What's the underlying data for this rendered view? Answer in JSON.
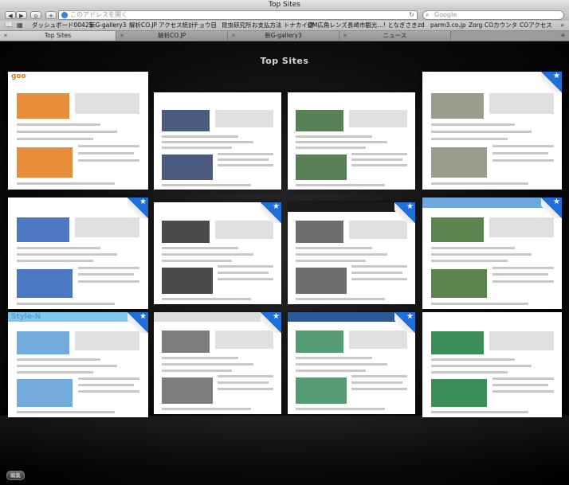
{
  "window": {
    "title": "Top Sites"
  },
  "toolbar": {
    "back_glyph": "◀",
    "forward_glyph": "▶",
    "home_glyph": "⌂",
    "add_glyph": "+",
    "address_placeholder": "このアドレスを開く",
    "reload_glyph": "↻",
    "search_placeholder": "Google",
    "search_glyph": "⌕"
  },
  "bookmarks": {
    "book_glyph": "📖",
    "grid_glyph": "▦",
    "items": [
      "ダッシュボード00425",
      "新G-gallery3",
      "解析CO.JP",
      "アクセス統計",
      "チョウ目",
      "昆虫研究所",
      "お支払方法 トナカイ便",
      "OM広角レンズ",
      "長崎市観光…! となぎさき",
      "zd",
      "parm3.co.jp",
      "Zorg",
      "COカウンタ",
      "COアクセス"
    ],
    "more_glyph": "»"
  },
  "tabs": {
    "items": [
      "Top Sites",
      "解析CO.JP",
      "新G-gallery3",
      "ニュース"
    ],
    "close_glyph": "✕",
    "new_tab_glyph": "+"
  },
  "top_sites": {
    "heading": "Top Sites",
    "pin_glyph": "★",
    "edit_label": "編集",
    "thumbs": [
      {
        "hdr": "#ffffff",
        "accent": "#e47a19",
        "pinned": false,
        "text": "goo"
      },
      {
        "hdr": "#ffffff",
        "accent": "#2c3e6a",
        "pinned": false
      },
      {
        "hdr": "#ffffff",
        "accent": "#3a6a3a",
        "pinned": false
      },
      {
        "hdr": "#ffffff",
        "accent": "#8a8a7a",
        "pinned": true
      },
      {
        "hdr": "#ffffff",
        "accent": "#2d5fb8",
        "pinned": true
      },
      {
        "hdr": "#ffffff",
        "accent": "#2a2a2a",
        "pinned": true
      },
      {
        "hdr": "#1a1a1a",
        "accent": "#555555",
        "pinned": true
      },
      {
        "hdr": "#6fa8dc",
        "accent": "#3f6f2f",
        "pinned": true
      },
      {
        "hdr": "#7ec8ee",
        "accent": "#5a9cd6",
        "pinned": true,
        "text": "Style-N"
      },
      {
        "hdr": "#dddddd",
        "accent": "#666666",
        "pinned": true
      },
      {
        "hdr": "#2a5a9a",
        "accent": "#3a8a5a",
        "pinned": true
      },
      {
        "hdr": "#ffffff",
        "accent": "#1a7a3a",
        "pinned": false
      }
    ]
  }
}
